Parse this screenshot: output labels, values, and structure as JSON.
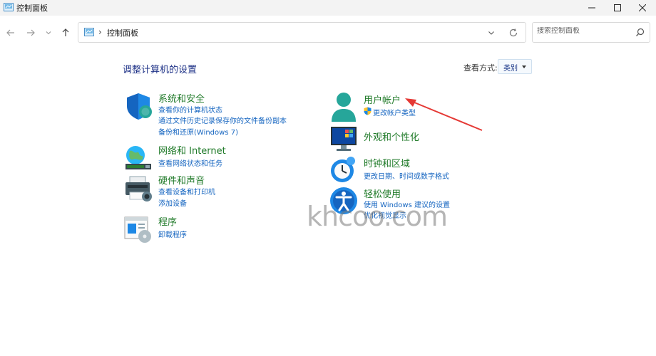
{
  "window": {
    "title": "控制面板"
  },
  "address": {
    "crumb": "控制面板",
    "separator": "›"
  },
  "search": {
    "placeholder": "搜索控制面板"
  },
  "content": {
    "heading": "调整计算机的设置",
    "view_by_label": "查看方式:",
    "view_by_value": "类别"
  },
  "categories": {
    "system": {
      "title": "系统和安全",
      "links": [
        "查看你的计算机状态",
        "通过文件历史记录保存你的文件备份副本",
        "备份和还原(Windows 7)"
      ]
    },
    "network": {
      "title": "网络和 Internet",
      "links": [
        "查看网络状态和任务"
      ]
    },
    "hardware": {
      "title": "硬件和声音",
      "links": [
        "查看设备和打印机",
        "添加设备"
      ]
    },
    "programs": {
      "title": "程序",
      "links": [
        "卸载程序"
      ]
    },
    "user": {
      "title": "用户帐户",
      "links": [
        "更改帐户类型"
      ]
    },
    "appearance": {
      "title": "外观和个性化",
      "links": []
    },
    "clock": {
      "title": "时钟和区域",
      "links": [
        "更改日期、时间或数字格式"
      ]
    },
    "ease": {
      "title": "轻松使用",
      "links": [
        "使用 Windows 建议的设置",
        "优化视觉显示"
      ]
    }
  },
  "watermark": "khcoo.com",
  "colors": {
    "category_title": "#1f7a28",
    "link": "#1565c0",
    "heading": "#1e3287",
    "arrow": "#e53935"
  }
}
